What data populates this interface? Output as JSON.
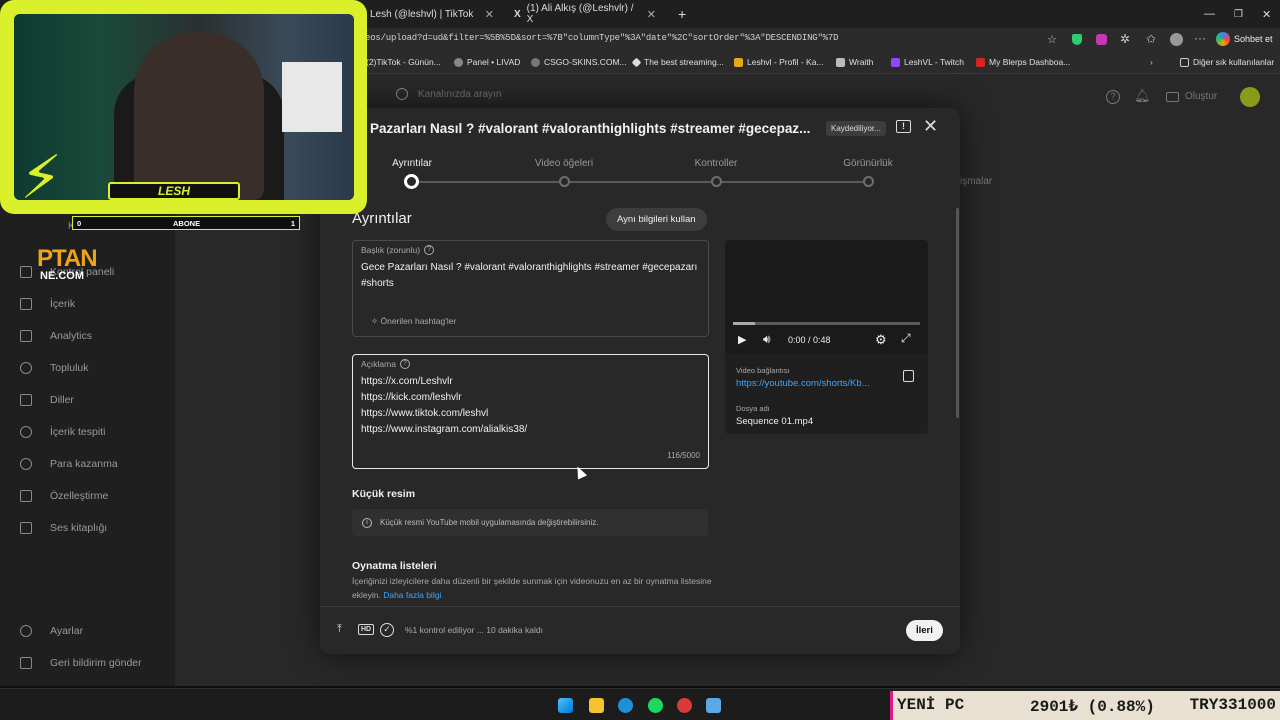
{
  "browser": {
    "tabs": [
      {
        "label": "Lesh (@leshvl) | TikTok"
      },
      {
        "label": "(1) Ali Alkış (@Leshvlr) / X"
      }
    ],
    "url": "eos/upload?d=ud&filter=%5B%5D&sort=%7B\"columnType\"%3A\"date\"%2C\"sortOrder\"%3A\"DESCENDING\"%7D",
    "chat_label": "Sohbet et",
    "bookmarks": [
      "(2)TikTok - Günün...",
      "Panel • LIVAD",
      "CSGO-SKINS.COM...",
      "The best streaming...",
      "Leshvl - Profil - Ka...",
      "Wraith",
      "LeshVL - Twitch",
      "My Blerps Dashboa...",
      "Diğer sık kullanılanlar"
    ]
  },
  "studio": {
    "search_placeholder": "Kanalınızda arayın",
    "create_label": "Oluştur",
    "sidebar": [
      {
        "label": "Kontrol paneli",
        "icon": "grid-icon"
      },
      {
        "label": "İçerik",
        "icon": "play-icon"
      },
      {
        "label": "Analytics",
        "icon": "chart-icon"
      },
      {
        "label": "Topluluk",
        "icon": "people-icon"
      },
      {
        "label": "Diller",
        "icon": "subtitles-icon"
      },
      {
        "label": "İçerik tespiti",
        "icon": "copyright-icon"
      },
      {
        "label": "Para kazanma",
        "icon": "dollar-icon"
      },
      {
        "label": "Özelleştirme",
        "icon": "wand-icon"
      },
      {
        "label": "Ses kitaplığı",
        "icon": "music-icon"
      }
    ],
    "sidebar_bottom": [
      "Ayarlar",
      "Geri bildirim gönder"
    ],
    "bg_tab": "işmalar",
    "channel_label": "Kanalınız"
  },
  "modal": {
    "title": "Pazarları Nasıl ? #valorant #valoranthighlights #streamer #gecepaz...",
    "saving": "Kaydediliyor...",
    "steps": [
      "Ayrıntılar",
      "Video öğeleri",
      "Kontroller",
      "Görünürlük"
    ],
    "section_title": "Ayrıntılar",
    "reuse_button": "Aynı bilgileri kullan",
    "title_field": {
      "label": "Başlık (zorunlu)",
      "line1": "Gece Pazarları Nasıl ? #valorant #valoranthighlights #streamer #gecepazarı",
      "line2": "#shorts",
      "hashtags": "Önerilen hashtag'ler"
    },
    "desc_field": {
      "label": "Açıklama",
      "lines": [
        "https://x.com/Leshvlr",
        "https://kick.com/leshvlr",
        "https://www.tiktok.com/leshvl",
        "https://www.instagram.com/alialkis38/"
      ],
      "counter": "116/5000"
    },
    "thumb_title": "Küçük resim",
    "thumb_info": "Küçük resmi YouTube mobil uygulamasında değiştirebilirsiniz.",
    "playlist_title": "Oynatma listeleri",
    "playlist_text": "İçeriğinizi izleyicilere daha düzenli bir şekilde sunmak için videonuzu en az bir oynatma listesine ekleyin.",
    "playlist_link": "Daha fazla bilgi",
    "video": {
      "time": "0:00 / 0:48",
      "progress": 0.12,
      "link_label": "Video bağlantısı",
      "link": "https://youtube.com/shorts/Kb...",
      "file_label": "Dosya adı",
      "file": "Sequence 01.mp4"
    },
    "footer_status": "%1 kontrol ediliyor ... 10 dakika kaldı",
    "next_button": "İleri"
  },
  "overlay": {
    "name": "LESH",
    "sub_left": "0",
    "sub_label": "ABONE",
    "sub_right": "1",
    "brand1": "PTAN",
    "brand2": "NE.COM"
  },
  "ticker": {
    "left": "YENİ PC",
    "mid": "2901₺ (0.88%)",
    "right": "TRY331000"
  },
  "colors": {
    "accent": "#d9f02a",
    "link": "#3ea6ff",
    "ticker_bar": "#e0188a"
  }
}
